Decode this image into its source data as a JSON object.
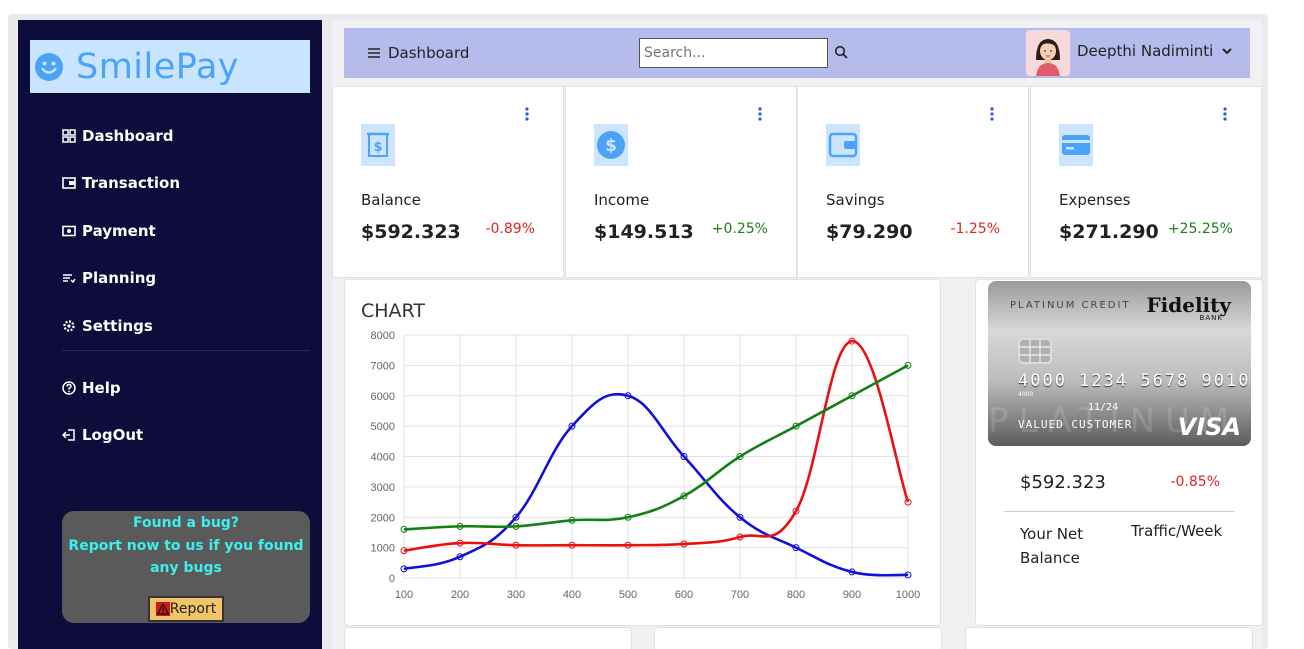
{
  "app": {
    "name": "SmilePay"
  },
  "sidebar": {
    "items": [
      {
        "label": "Dashboard",
        "icon": "grid-icon"
      },
      {
        "label": "Transaction",
        "icon": "wallet-icon"
      },
      {
        "label": "Payment",
        "icon": "cash-icon"
      },
      {
        "label": "Planning",
        "icon": "list-icon"
      },
      {
        "label": "Settings",
        "icon": "gear-icon"
      }
    ],
    "secondary": [
      {
        "label": "Help",
        "icon": "help-icon"
      },
      {
        "label": "LogOut",
        "icon": "logout-icon"
      }
    ],
    "bug": {
      "title": "Found a bug?",
      "text": "Report now to us if you found any bugs",
      "button_label": "Report"
    }
  },
  "topbar": {
    "menu_label": "Dashboard",
    "search_placeholder": "Search...",
    "user_name": "Deepthi Nadiminti"
  },
  "stats": [
    {
      "label": "Balance",
      "value": "$592.323",
      "change": "-0.89%",
      "trend": "down"
    },
    {
      "label": "Income",
      "value": "$149.513",
      "change": "+0.25%",
      "trend": "up"
    },
    {
      "label": "Savings",
      "value": "$79.290",
      "change": "-1.25%",
      "trend": "down"
    },
    {
      "label": "Expenses",
      "value": "$271.290",
      "change": "+25.25%",
      "trend": "up"
    }
  ],
  "chart": {
    "title": "CHART"
  },
  "chart_data": {
    "type": "line",
    "title": "CHART",
    "x": [
      100,
      200,
      300,
      400,
      500,
      600,
      700,
      800,
      900,
      1000
    ],
    "ylim": [
      0,
      8000
    ],
    "yticks": [
      0,
      1000,
      2000,
      3000,
      4000,
      5000,
      6000,
      7000,
      8000
    ],
    "grid": true,
    "series": [
      {
        "color": "#1010d8",
        "values": [
          300,
          700,
          2000,
          5000,
          6000,
          4000,
          2000,
          1000,
          200,
          100
        ]
      },
      {
        "color": "#e81010",
        "values": [
          900,
          1150,
          1080,
          1080,
          1080,
          1120,
          1350,
          2200,
          7800,
          2500
        ]
      },
      {
        "color": "#128012",
        "values": [
          1600,
          1700,
          1700,
          1900,
          2000,
          2700,
          4000,
          5000,
          6000,
          7000
        ]
      }
    ]
  },
  "card": {
    "type_label": "PLATINUM CREDIT",
    "bank_name": "Fidelity",
    "bank_sub": "BANK",
    "number": "4000 1234 5678 9010",
    "number_small": "4000",
    "expiry": "11/24",
    "holder": "VALUED CUSTOMER",
    "watermark": "PLATINUM",
    "network": "VISA",
    "net_value": "$592.323",
    "net_change": "-0.85%",
    "net_label": "Your Net Balance",
    "traffic_label": "Traffic/Week"
  },
  "colors": {
    "sidebar_bg": "#0d0c3a",
    "topbar_bg": "#b5bcec",
    "accent": "#4aa3f7",
    "negative": "#e02424",
    "positive": "#1b7f1b"
  }
}
